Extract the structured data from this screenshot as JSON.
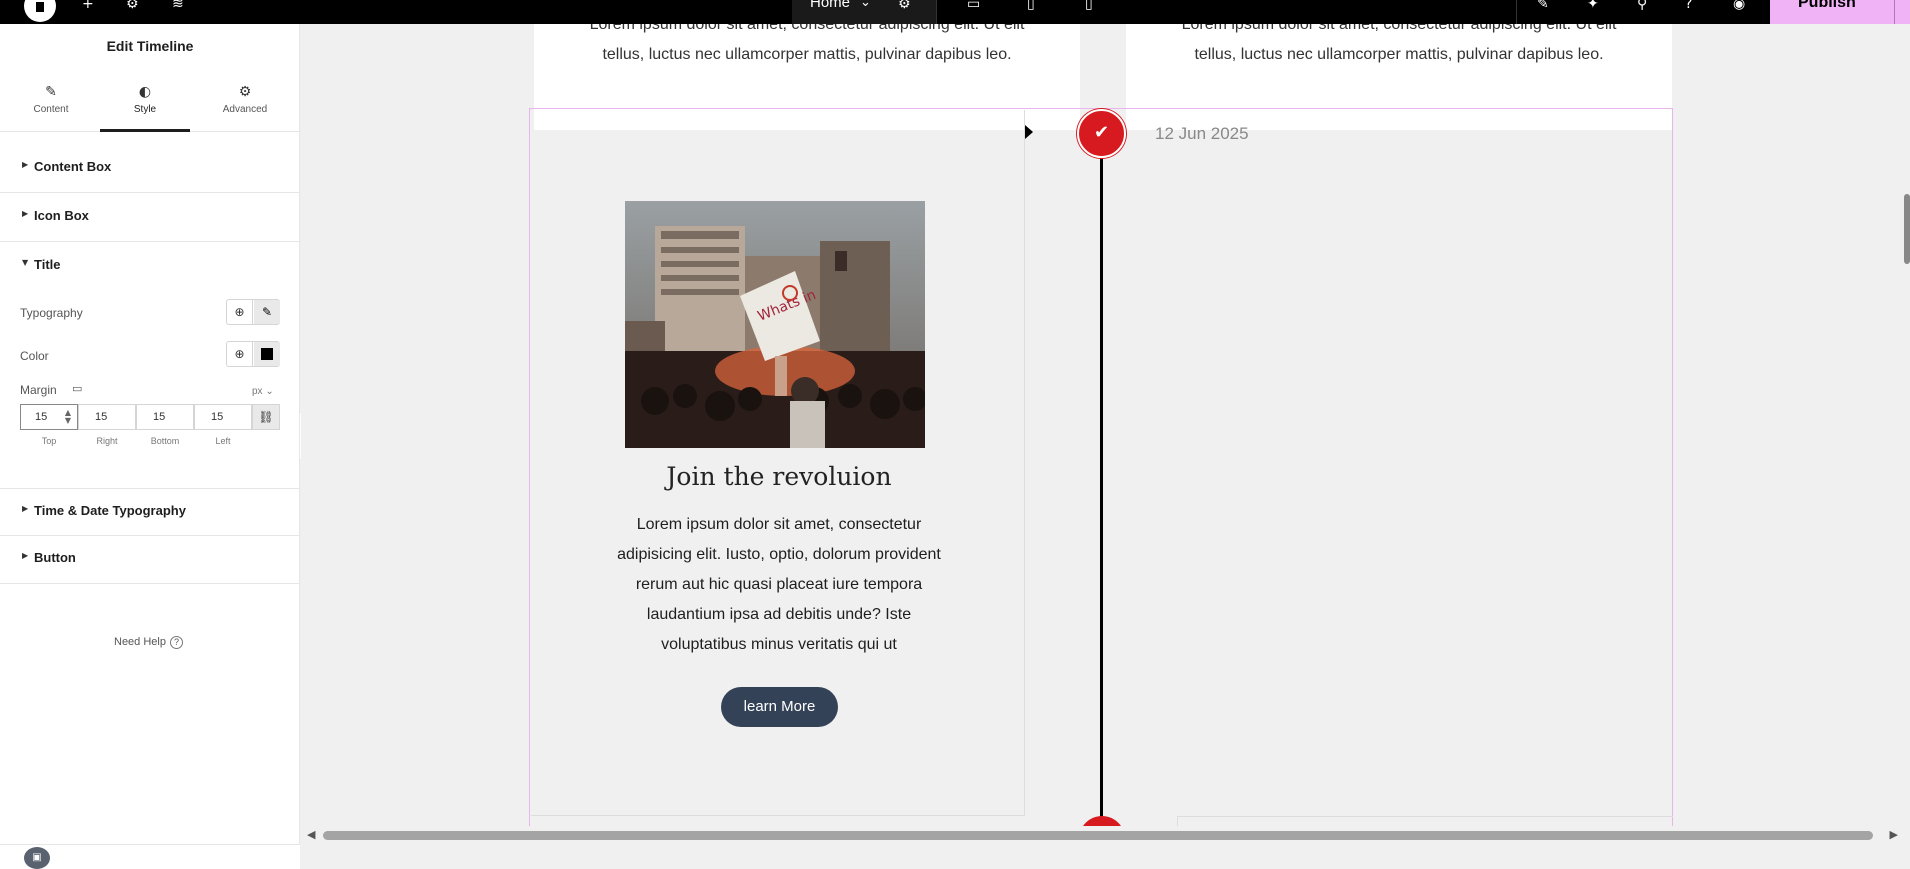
{
  "topbar": {
    "page_selector": "Home",
    "publish_label": "Publish"
  },
  "panel": {
    "title": "Edit Timeline",
    "tabs": [
      {
        "label": "Content",
        "icon": "pencil-icon"
      },
      {
        "label": "Style",
        "icon": "contrast-icon"
      },
      {
        "label": "Advanced",
        "icon": "gear-icon"
      }
    ],
    "sections": {
      "content_box": "Content Box",
      "icon_box": "Icon Box",
      "title": "Title",
      "time_date": "Time & Date Typography",
      "button": "Button"
    },
    "controls": {
      "typography": "Typography",
      "color": "Color",
      "margin": "Margin",
      "unit": "px"
    },
    "margin": {
      "top": "15",
      "right": "15",
      "bottom": "15",
      "left": "15",
      "labels": [
        "Top",
        "Right",
        "Bottom",
        "Left"
      ]
    },
    "help": "Need Help"
  },
  "canvas": {
    "top_cards": [
      {
        "line1": "Lorem ipsum dolor sit amet, consectetur adipiscing elit. Ut elit",
        "line2": "tellus, luctus nec ullamcorper mattis, pulvinar dapibus leo."
      },
      {
        "line1": "Lorem ipsum dolor sit amet, consectetur adipiscing elit. Ut elit",
        "line2": "tellus, luctus nec ullamcorper mattis, pulvinar dapibus leo."
      }
    ],
    "item": {
      "date": "12 Jun 2025",
      "title": "Join the revoluion",
      "body": "Lorem ipsum dolor sit amet, consectetur adipisicing elit. Iusto, optio, dolorum provident rerum aut hic quasi placeat iure tempora laudantium ipsa ad debitis unde? Iste voluptatibus minus veritatis qui ut",
      "button": "learn More"
    }
  },
  "colors": {
    "accent_publish": "#f0b3f5",
    "timeline_dot": "#d61a1f",
    "button_bg": "#334257"
  }
}
